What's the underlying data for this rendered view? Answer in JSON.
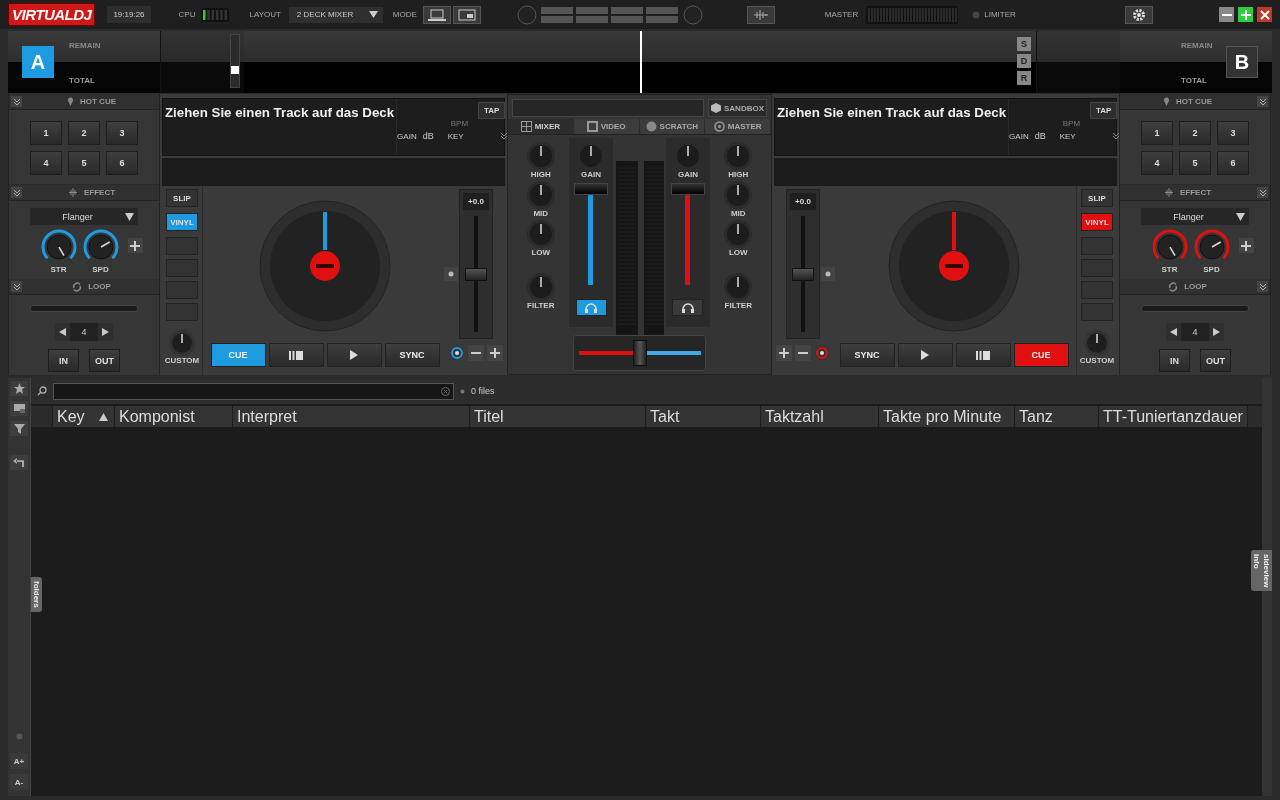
{
  "topbar": {
    "logo": "VIRTUALDJ",
    "clock": "19:19:26",
    "cpu_label": "CPU",
    "layout_label": "LAYOUT",
    "layout_value": "2 DECK MIXER",
    "mode_label": "MODE",
    "master_label": "MASTER",
    "limiter_label": "LIMITER"
  },
  "waveform": {
    "decks": [
      {
        "letter": "A",
        "active": true,
        "remain": "REMAIN",
        "total": "TOTAL"
      },
      {
        "letter": "B",
        "active": false,
        "remain": "REMAIN",
        "total": "TOTAL"
      }
    ],
    "zoom": {
      "level": 0.3
    },
    "buttons": [
      "S",
      "D",
      "R"
    ]
  },
  "decks": [
    {
      "color": "#1e9be0",
      "hotcue_title": "HOT CUE",
      "pads": [
        "1",
        "2",
        "3",
        "4",
        "5",
        "6"
      ],
      "effect_title": "EFFECT",
      "effect": "Flanger",
      "knobs": [
        "STR",
        "SPD"
      ],
      "loop_title": "LOOP",
      "loop_bar": {
        "level": 0
      },
      "loop_size": "4",
      "loop_buttons": [
        "IN",
        "OUT"
      ],
      "track": "Ziehen Sie einen Track auf das Deck",
      "tap": "TAP",
      "bpm": "BPM",
      "gain": "GAIN",
      "db": "dB",
      "key": "KEY",
      "slip": "SLIP",
      "vinyl": "VINYL",
      "vinyl_on": true,
      "custom": "CUSTOM",
      "pitch": {
        "reading": "+0.0",
        "level": 0.5
      },
      "cue": "CUE",
      "sync": "SYNC"
    },
    {
      "color": "#e01010",
      "hotcue_title": "HOT CUE",
      "pads": [
        "1",
        "2",
        "3",
        "4",
        "5",
        "6"
      ],
      "effect_title": "EFFECT",
      "effect": "Flanger",
      "knobs": [
        "STR",
        "SPD"
      ],
      "loop_title": "LOOP",
      "loop_bar": {
        "level": 0
      },
      "loop_size": "4",
      "loop_buttons": [
        "IN",
        "OUT"
      ],
      "track": "Ziehen Sie einen Track auf das Deck",
      "tap": "TAP",
      "bpm": "BPM",
      "gain": "GAIN",
      "db": "dB",
      "key": "KEY",
      "slip": "SLIP",
      "vinyl": "VINYL",
      "vinyl_on": true,
      "custom": "CUSTOM",
      "pitch": {
        "reading": "+0.0",
        "level": 0.5
      },
      "cue": "CUE",
      "sync": "SYNC"
    }
  ],
  "mixer": {
    "sandbox": "SANDBOX",
    "tabs": [
      {
        "label": "MIXER",
        "selected": true
      },
      {
        "label": "VIDEO",
        "selected": false
      },
      {
        "label": "SCRATCH",
        "selected": false
      },
      {
        "label": "MASTER",
        "selected": false
      }
    ],
    "channels": [
      {
        "eq": [
          "HIGH",
          "MID",
          "LOW",
          "FILTER"
        ],
        "gain": "GAIN",
        "level": 1,
        "pfl": true,
        "color": "#1e9be0"
      },
      {
        "eq": [
          "HIGH",
          "MID",
          "LOW",
          "FILTER"
        ],
        "gain": "GAIN",
        "level": 1,
        "pfl": false,
        "color": "#e01010"
      }
    ],
    "crossfader": {
      "level": 0.5
    }
  },
  "browser": {
    "count": "0 files",
    "columns": [
      {
        "label": "Key",
        "sorted": true
      },
      {
        "label": "Komponist",
        "sorted": false
      },
      {
        "label": "Interpret",
        "sorted": false
      },
      {
        "label": "Titel",
        "sorted": false
      },
      {
        "label": "Takt",
        "sorted": false
      },
      {
        "label": "Taktzahl",
        "sorted": false
      },
      {
        "label": "Takte pro Minute",
        "sorted": false
      },
      {
        "label": "Tanz",
        "sorted": false
      },
      {
        "label": "TT-Tuniertanzdauer",
        "sorted": false
      }
    ],
    "left_tab": "folders",
    "right_tabs": [
      "sideview",
      "info"
    ],
    "font_buttons": [
      "A+",
      "A-"
    ]
  }
}
